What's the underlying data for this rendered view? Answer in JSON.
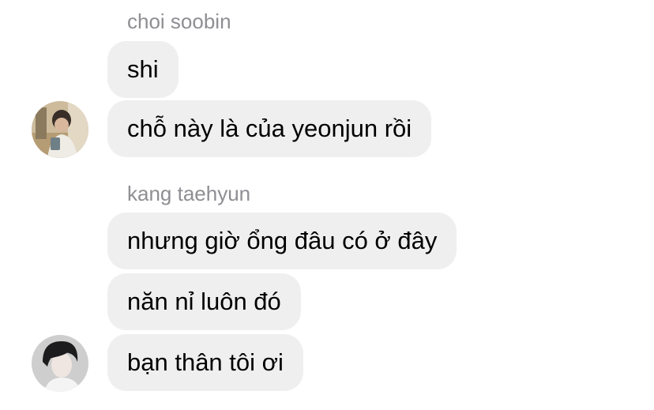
{
  "conversation": {
    "groups": [
      {
        "sender": "choi soobin",
        "messages": [
          "shi",
          "chỗ này là của yeonjun rồi"
        ]
      },
      {
        "sender": "kang taehyun",
        "messages": [
          "nhưng giờ ổng đâu có ở đây",
          "năn nỉ luôn đó",
          "bạn thân tôi ơi"
        ]
      }
    ]
  },
  "colors": {
    "bubble": "#efefef",
    "sender_name": "#8e8e93",
    "message_text": "#000000",
    "background": "#ffffff"
  },
  "icons": {
    "avatar_1": "profile-photo-avatar",
    "avatar_2": "profile-photo-avatar"
  }
}
